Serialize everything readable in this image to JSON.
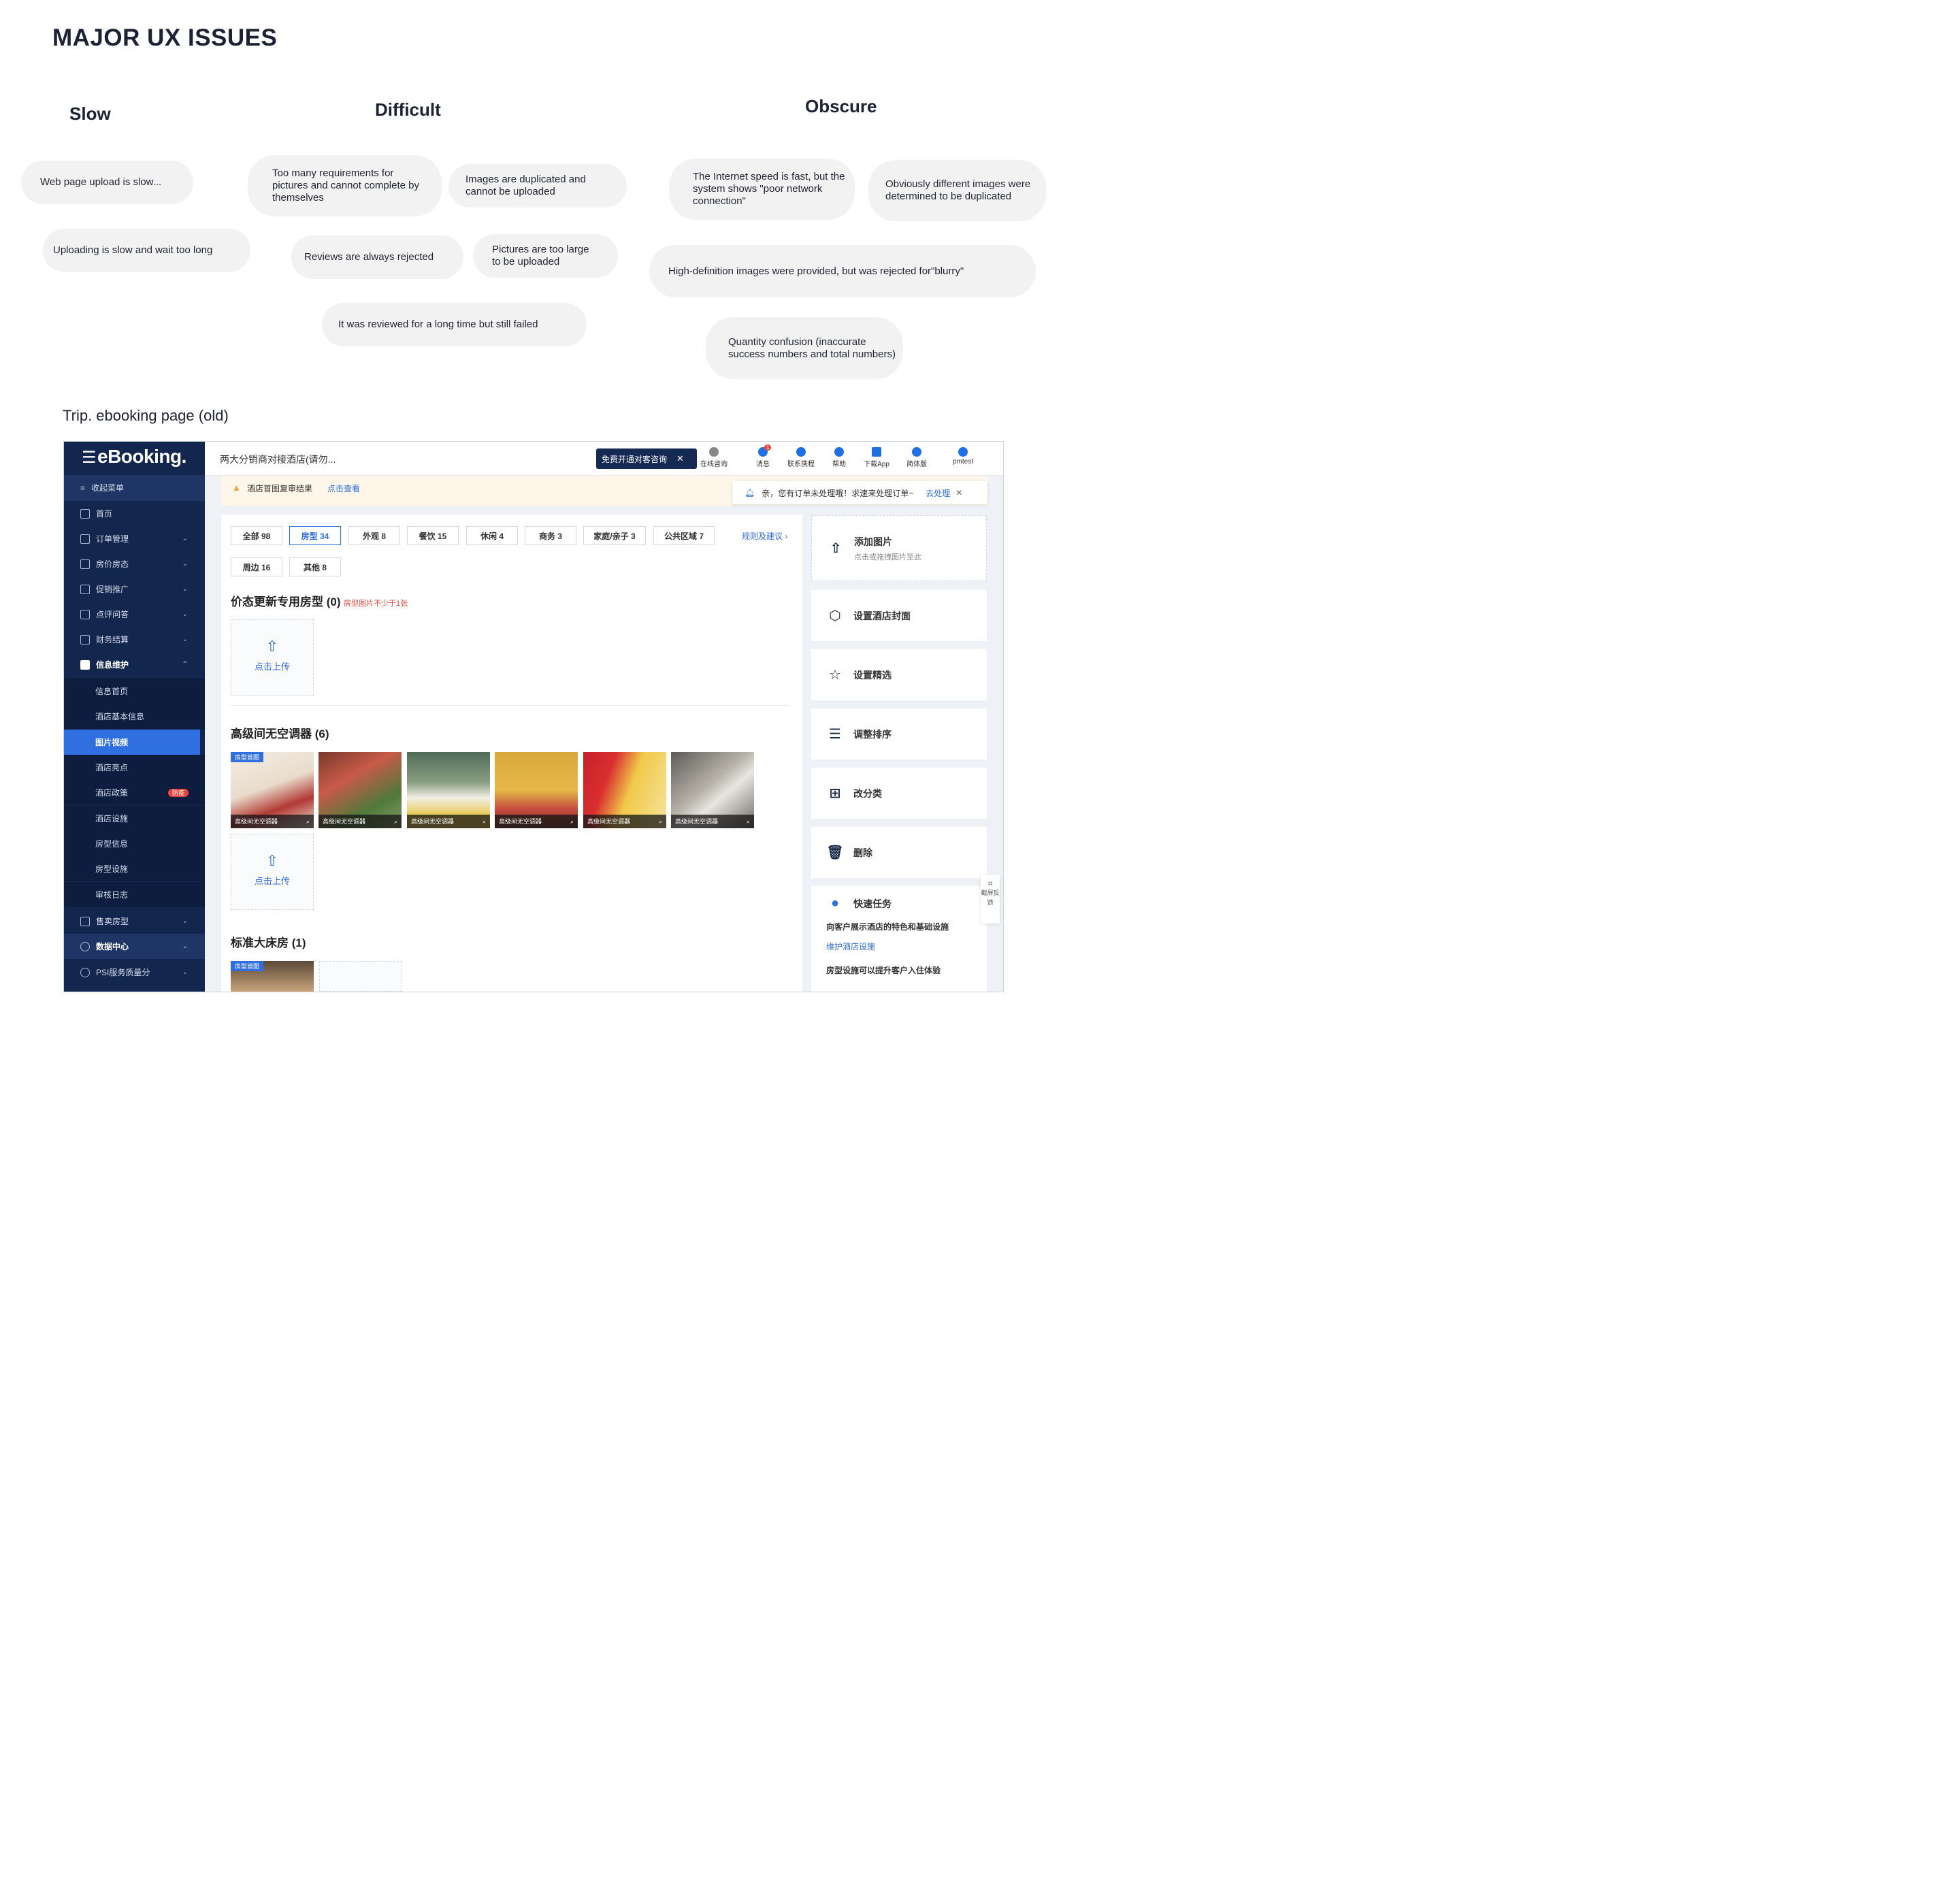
{
  "page_title": "MAJOR UX ISSUES",
  "columns": [
    {
      "title": "Slow"
    },
    {
      "title": "Difficult"
    },
    {
      "title": "Obscure"
    }
  ],
  "issues": {
    "slow": [
      "Web page upload is slow...",
      "Uploading is slow and wait too long"
    ],
    "difficult": [
      "Too many requirements for pictures and cannot complete by themselves",
      "Images are duplicated and cannot be uploaded",
      "Reviews are always rejected",
      "Pictures are too large to be uploaded",
      "It was reviewed for a long time but still failed"
    ],
    "obscure": [
      "The Internet speed is fast, but the system shows \"poor network connection\"",
      "Obviously different images were determined to be duplicated",
      "High-definition images were provided, but was rejected for\"blurry\"",
      "Quantity confusion (inaccurate success numbers and total numbers)"
    ]
  },
  "screenshot_label": "Trip. ebooking  page  (old)",
  "ebooking": {
    "logo": "eBooking.",
    "sidebar": {
      "collapse": "收起菜单",
      "items": [
        "首页",
        "订单管理",
        "房价房态",
        "促销推广",
        "点评问答",
        "财务结算",
        "信息维护"
      ],
      "sub_items": [
        "信息首页",
        "酒店基本信息",
        "图片视频",
        "酒店亮点",
        "酒店政策",
        "酒店设施",
        "房型信息",
        "房型设施",
        "审核日志"
      ],
      "policy_badge": "防疫",
      "bottom_items": [
        "售卖房型",
        "数据中心",
        "PSI服务质量分"
      ]
    },
    "topbar": {
      "hotel_name": "两大分销商对接酒店(请勿...",
      "promo": "免费开通对客咨询",
      "icons": [
        "在线咨询",
        "消息",
        "联系携程",
        "帮助",
        "下载App",
        "简体版",
        "pmtest"
      ],
      "message_count": "1"
    },
    "notice": {
      "text": "酒店首图复审结果",
      "link": "点击查看"
    },
    "toast": {
      "text": "亲，您有订单未处理哦！求速来处理订单~",
      "action": "去处理"
    },
    "tabs": [
      "全部 98",
      "房型 34",
      "外观 8",
      "餐饮 15",
      "休闲 4",
      "商务 3",
      "家庭/亲子 3",
      "公共区域 7",
      "周边 16",
      "其他 8"
    ],
    "rules_link": "规则及建议 ›",
    "sections": [
      {
        "title": "价态更新专用房型 (0)",
        "warning": "房型图片不少于1张"
      },
      {
        "title": "高级间无空调器 (6)"
      },
      {
        "title": "标准大床房 (1)"
      }
    ],
    "upload_label": "点击上传",
    "cover_tag": "房型首图",
    "photo_caption": "高级间无空调器",
    "right_panel": {
      "add_title": "添加图片",
      "add_sub": "点击或拖拽图片至此",
      "actions": [
        "设置酒店封面",
        "设置精选",
        "调整排序",
        "改分类",
        "删除"
      ],
      "quick_title": "快速任务",
      "quick_desc": "向客户展示酒店的特色和基础设施",
      "quick_link": "维护酒店设施",
      "quick_desc2": "房型设施可以提升客户入住体验"
    },
    "feedback": "截屏反馈"
  }
}
